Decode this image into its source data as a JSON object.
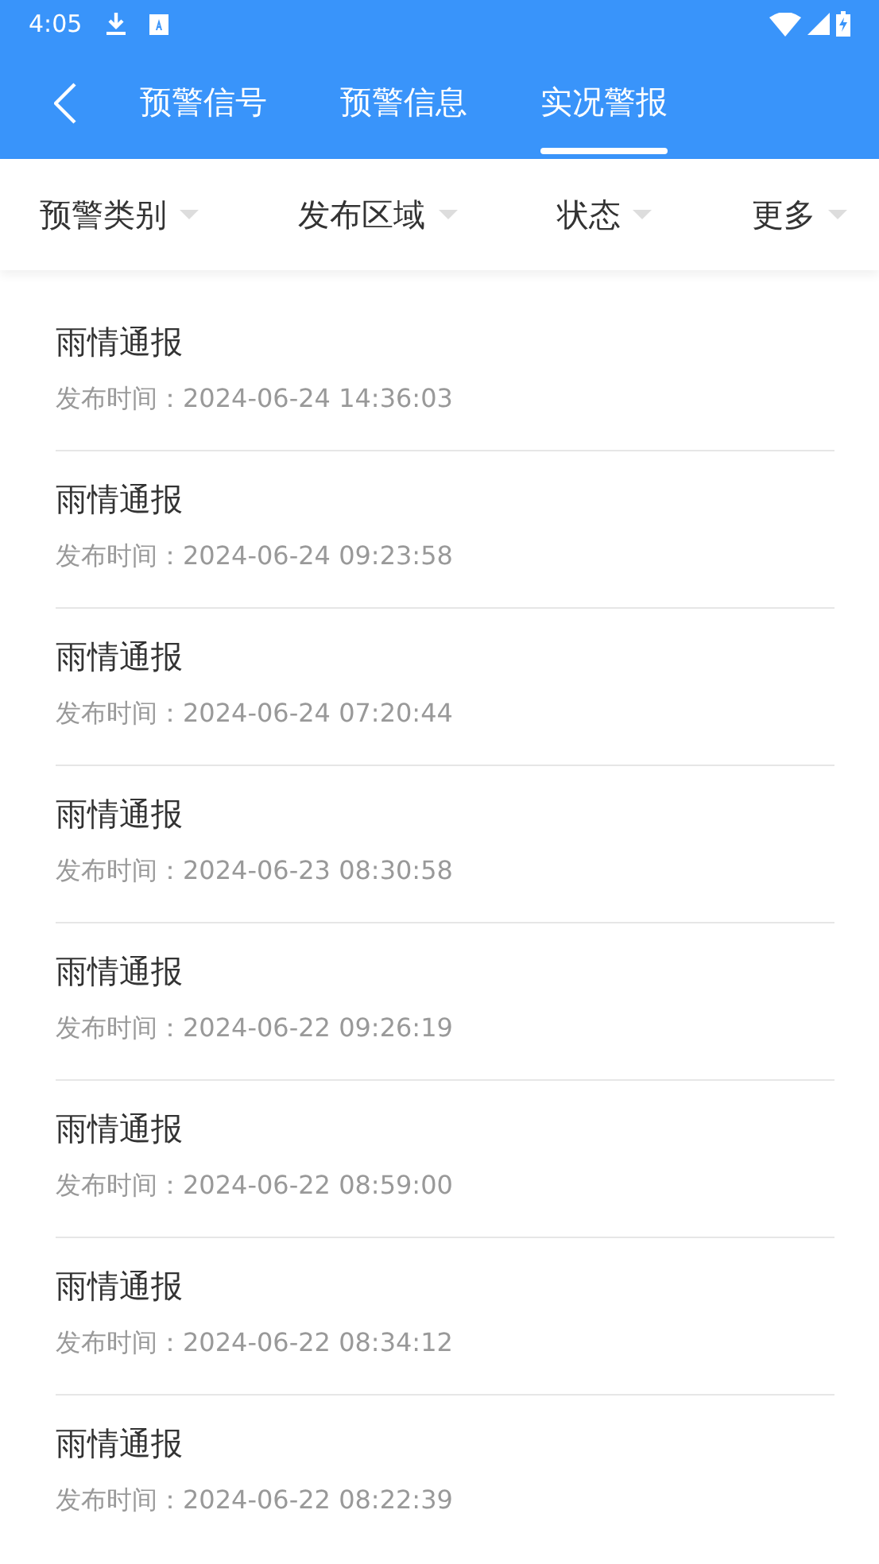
{
  "status_bar": {
    "time": "4:05"
  },
  "tabs": [
    {
      "label": "预警信号",
      "selected": false
    },
    {
      "label": "预警信息",
      "selected": false
    },
    {
      "label": "实况警报",
      "selected": true
    }
  ],
  "filters": [
    {
      "label": "预警类别"
    },
    {
      "label": "发布区域"
    },
    {
      "label": "状态"
    },
    {
      "label": "更多"
    }
  ],
  "reports": [
    {
      "title": "雨情通报",
      "time": "发布时间：2024-06-24 14:36:03"
    },
    {
      "title": "雨情通报",
      "time": "发布时间：2024-06-24 09:23:58"
    },
    {
      "title": "雨情通报",
      "time": "发布时间：2024-06-24 07:20:44"
    },
    {
      "title": "雨情通报",
      "time": "发布时间：2024-06-23 08:30:58"
    },
    {
      "title": "雨情通报",
      "time": "发布时间：2024-06-22 09:26:19"
    },
    {
      "title": "雨情通报",
      "time": "发布时间：2024-06-22 08:59:00"
    },
    {
      "title": "雨情通报",
      "time": "发布时间：2024-06-22 08:34:12"
    },
    {
      "title": "雨情通报",
      "time": "发布时间：2024-06-22 08:22:39"
    }
  ]
}
